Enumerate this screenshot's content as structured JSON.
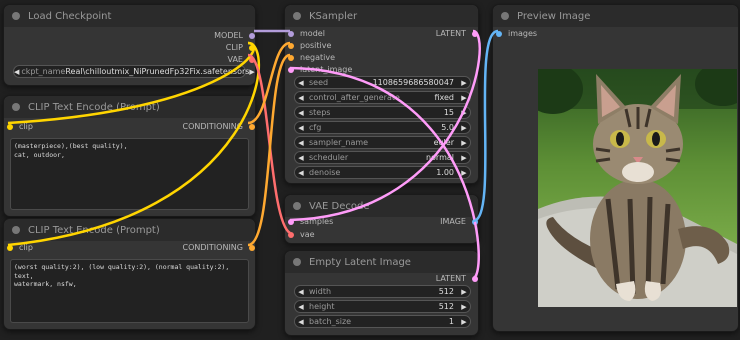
{
  "nodes": {
    "load_checkpoint": {
      "title": "Load Checkpoint",
      "outputs": [
        "MODEL",
        "CLIP",
        "VAE"
      ],
      "widget": {
        "name": "ckpt_name",
        "value": "Real\\chilloutmix_NiPrunedFp32Fix.safetensors"
      }
    },
    "clip_pos": {
      "title": "CLIP Text Encode (Prompt)",
      "input": "clip",
      "output": "CONDITIONING",
      "text": "(masterpiece),(best quality),\ncat, outdoor,"
    },
    "clip_neg": {
      "title": "CLIP Text Encode (Prompt)",
      "input": "clip",
      "output": "CONDITIONING",
      "text": "(worst quality:2), (low quality:2), (normal quality:2), text,\nwatermark, nsfw,"
    },
    "ksampler": {
      "title": "KSampler",
      "inputs": [
        "model",
        "positive",
        "negative",
        "latent_image"
      ],
      "output": "LATENT",
      "widgets": [
        {
          "name": "seed",
          "value": "1108659686580047"
        },
        {
          "name": "control_after_generate",
          "value": "fixed"
        },
        {
          "name": "steps",
          "value": "15"
        },
        {
          "name": "cfg",
          "value": "5.0"
        },
        {
          "name": "sampler_name",
          "value": "euler"
        },
        {
          "name": "scheduler",
          "value": "normal"
        },
        {
          "name": "denoise",
          "value": "1.00"
        }
      ]
    },
    "vae_decode": {
      "title": "VAE Decode",
      "inputs": [
        "samples",
        "vae"
      ],
      "output": "IMAGE"
    },
    "empty_latent": {
      "title": "Empty Latent Image",
      "output": "LATENT",
      "widgets": [
        {
          "name": "width",
          "value": "512"
        },
        {
          "name": "height",
          "value": "512"
        },
        {
          "name": "batch_size",
          "value": "1"
        }
      ]
    },
    "preview": {
      "title": "Preview Image",
      "input": "images"
    }
  },
  "colors": {
    "model": "#b39ddb",
    "clip": "#ffd500",
    "vae": "#ff6e6e",
    "conditioning": "#ffa931",
    "latent": "#ff9cf9",
    "image": "#64b5f6",
    "background": "#202020",
    "node": "#353535",
    "title_bar": "#2b2b2b"
  }
}
